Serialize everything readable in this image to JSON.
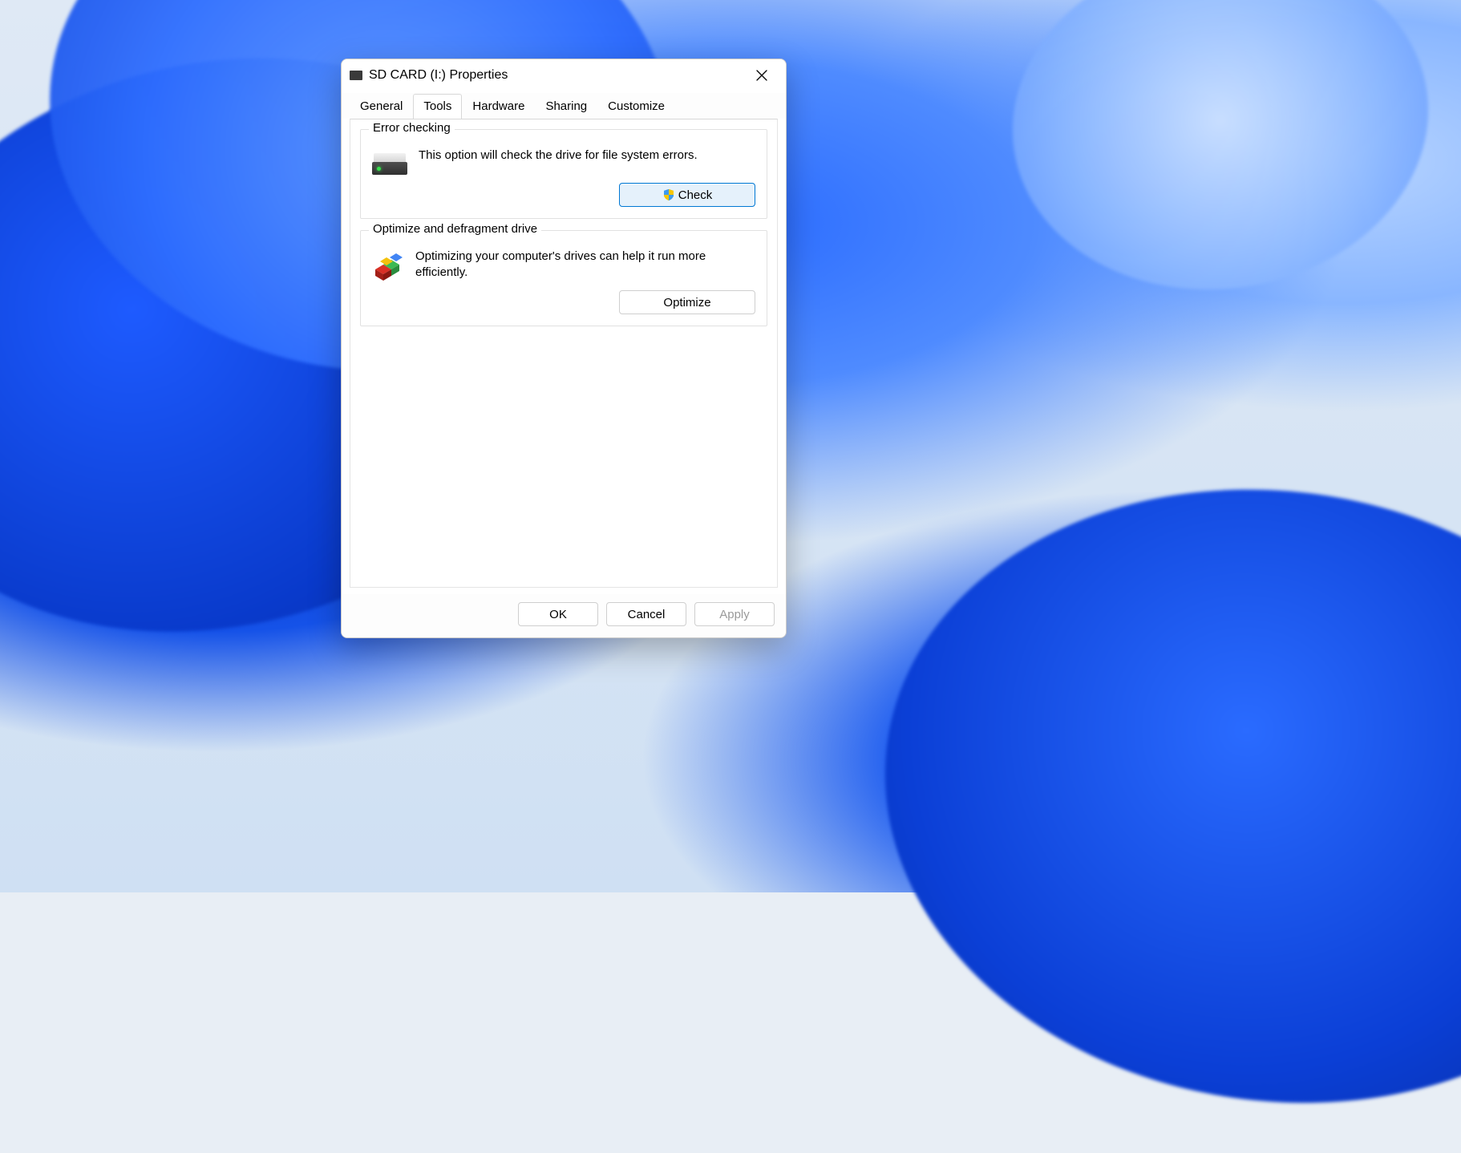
{
  "window": {
    "title": "SD CARD (I:) Properties"
  },
  "tabs": {
    "items": [
      {
        "label": "General",
        "active": false
      },
      {
        "label": "Tools",
        "active": true
      },
      {
        "label": "Hardware",
        "active": false
      },
      {
        "label": "Sharing",
        "active": false
      },
      {
        "label": "Customize",
        "active": false
      }
    ]
  },
  "error_checking": {
    "title": "Error checking",
    "description": "This option will check the drive for file system errors.",
    "button_label": "Check"
  },
  "optimize": {
    "title": "Optimize and defragment drive",
    "description": "Optimizing your computer's drives can help it run more efficiently.",
    "button_label": "Optimize"
  },
  "footer": {
    "ok_label": "OK",
    "cancel_label": "Cancel",
    "apply_label": "Apply"
  }
}
